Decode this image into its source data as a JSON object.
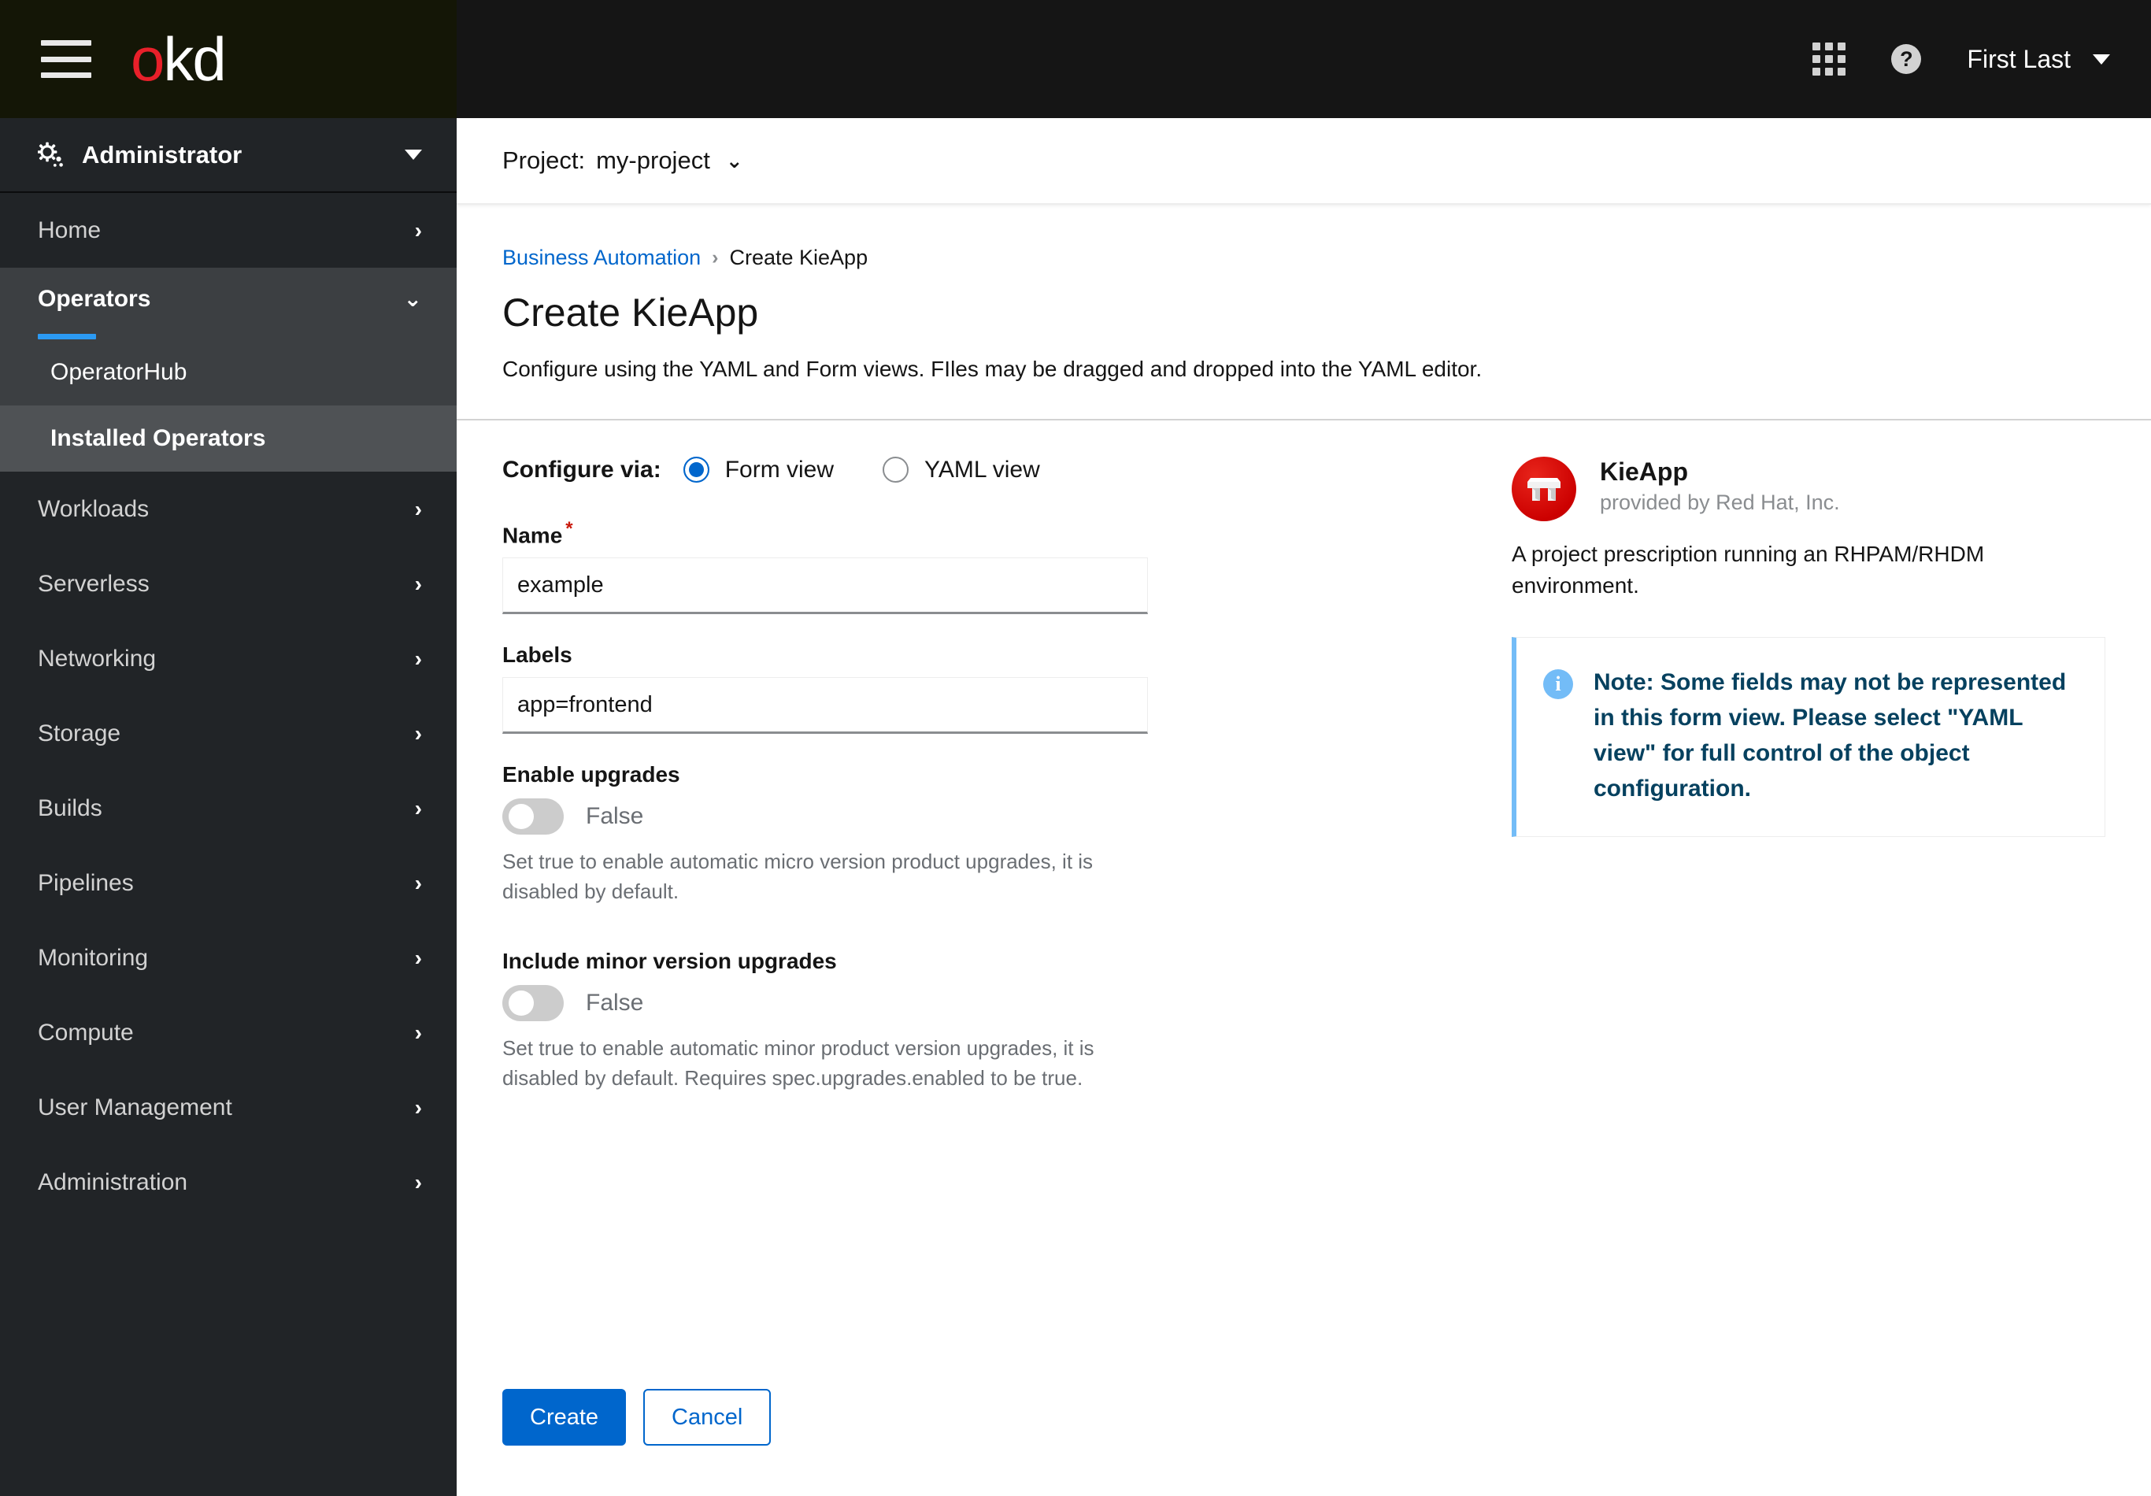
{
  "masthead": {
    "logo_o": "o",
    "logo_kd": "kd",
    "hamburger_icon": "hamburger-menu-icon",
    "apps_icon": "app-launcher-grid-icon",
    "help_icon": "help-question-icon",
    "help_glyph": "?",
    "user_name": "First Last",
    "user_caret_icon": "caret-down-icon"
  },
  "sidebar": {
    "perspective": {
      "label": "Administrator",
      "icon": "gear-icon",
      "caret_icon": "caret-down-icon"
    },
    "items": [
      {
        "label": "Home",
        "chevron": "›"
      },
      {
        "label": "Workloads",
        "chevron": "›"
      },
      {
        "label": "Serverless",
        "chevron": "›"
      },
      {
        "label": "Networking",
        "chevron": "›"
      },
      {
        "label": "Storage",
        "chevron": "›"
      },
      {
        "label": "Builds",
        "chevron": "›"
      },
      {
        "label": "Pipelines",
        "chevron": "›"
      },
      {
        "label": "Monitoring",
        "chevron": "›"
      },
      {
        "label": "Compute",
        "chevron": "›"
      },
      {
        "label": "User Management",
        "chevron": "›"
      },
      {
        "label": "Administration",
        "chevron": "›"
      }
    ],
    "operators_group": {
      "label": "Operators",
      "chevron": "⌄",
      "accent_color": "#2b9af3",
      "sub_items": [
        {
          "label": "OperatorHub",
          "selected": false
        },
        {
          "label": "Installed Operators",
          "selected": true
        }
      ]
    }
  },
  "project_bar": {
    "label": "Project:",
    "value": "my-project",
    "caret_icon": "chevron-down-icon",
    "caret_glyph": "⌄"
  },
  "breadcrumb": {
    "parent": "Business Automation",
    "separator": "›",
    "current": "Create KieApp"
  },
  "page": {
    "title": "Create KieApp",
    "subtitle": "Configure using the YAML and Form views. FIles may be dragged and dropped into the YAML editor."
  },
  "form": {
    "configure_via_label": "Configure via:",
    "options": [
      {
        "label": "Form view",
        "selected": true
      },
      {
        "label": "YAML view",
        "selected": false
      }
    ],
    "name_field": {
      "label": "Name",
      "required_mark": "*",
      "value": "example",
      "placeholder": ""
    },
    "labels_field": {
      "label": "Labels",
      "value": "app=frontend",
      "placeholder": ""
    },
    "enable_upgrades": {
      "label": "Enable upgrades",
      "value": "False",
      "help": "Set true to enable automatic micro version product upgrades, it is disabled by default."
    },
    "include_minor_upgrades": {
      "label": "Include minor version upgrades",
      "value": "False",
      "help": "Set true to enable automatic minor product version upgrades, it is disabled by default. Requires spec.upgrades.enabled to be true."
    },
    "create_label": "Create",
    "cancel_label": "Cancel"
  },
  "operator_panel": {
    "logo_icon": "kieapp-red-hat-logo-icon",
    "title": "KieApp",
    "provider": "provided by Red Hat, Inc.",
    "description": "A project prescription running an RHPAM/RHDM environment.",
    "note": {
      "icon": "info-circle-icon",
      "icon_glyph": "i",
      "text": "Note: Some fields may not be represented in this form view. Please select \"YAML view\" for full control of the object configuration.",
      "accent_color": "#73bcf7",
      "text_color": "#06415f"
    }
  },
  "colors": {
    "brand_red": "#e8202a",
    "primary_blue": "#06c",
    "nav_accent": "#2b9af3",
    "required_red": "#c9190b"
  }
}
